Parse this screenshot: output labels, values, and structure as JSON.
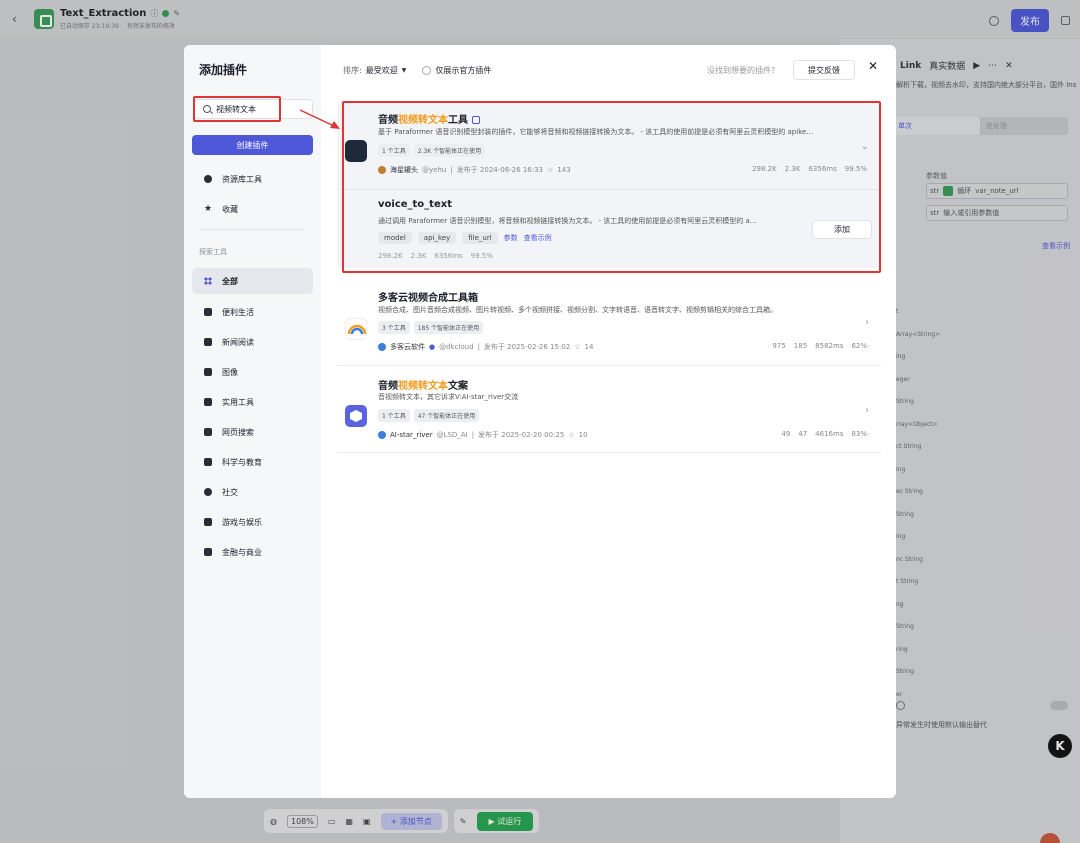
{
  "app": {
    "title": "Text_Extraction",
    "saved": "已自动保存 23:19:39",
    "unpublished": "有然未发布的修改",
    "publish": "发布"
  },
  "right_panel": {
    "title": "Link",
    "data_mode": "真实数据",
    "desc": "解析下载，视频去水印，支持国内绝大部分平台，国外 Instagram, Twitter, Tiktok, FaceBook, Vimeo。",
    "tab_single": "单次",
    "tab_batch": "批处理",
    "input_label": "参数值",
    "var_badge": "循环",
    "var_name": "var_note_url",
    "placeholder": "输入或引用参数值",
    "view_example": "查看示例",
    "type_rows": [
      "t",
      "Array<String>",
      "ing",
      "eger",
      "String",
      "rray<Object>",
      "ct  String",
      "ing",
      "ec  String",
      "String",
      "ing",
      "nc  String",
      "t  String",
      "ng",
      "String",
      "ring",
      "String",
      "er"
    ],
    "footer": "异常发生时使用默认输出替代"
  },
  "canvas": {
    "zoom": "108%",
    "add_node": "+ 添加节点",
    "run": "试运行"
  },
  "modal": {
    "title": "添加插件",
    "search_value": "视频转文本",
    "create_button": "创建插件",
    "nav_top": [
      {
        "label": "资源库工具",
        "icon": "person-icon"
      },
      {
        "label": "收藏",
        "icon": "star-icon"
      }
    ],
    "section_label": "探索工具",
    "nav_categories": [
      {
        "label": "全部",
        "icon": "grid-icon"
      },
      {
        "label": "便利生活",
        "icon": "cup-icon"
      },
      {
        "label": "新闻阅读",
        "icon": "book-icon"
      },
      {
        "label": "图像",
        "icon": "image-icon"
      },
      {
        "label": "实用工具",
        "icon": "wrench-icon"
      },
      {
        "label": "网页搜索",
        "icon": "cross-icon"
      },
      {
        "label": "科学与教育",
        "icon": "cap-icon"
      },
      {
        "label": "社交",
        "icon": "chat-icon"
      },
      {
        "label": "游戏与娱乐",
        "icon": "gamepad-icon"
      },
      {
        "label": "金融与商业",
        "icon": "coins-icon"
      }
    ],
    "sort_label": "排序:",
    "sort_value": "最受欢迎",
    "official_only": "仅展示官方插件",
    "missing": "没找到想要的插件?",
    "feedback": "提交反馈",
    "plugins": [
      {
        "name_pre": "音频",
        "name_hl": "视频转文本",
        "name_post": "工具",
        "desc": "基于 Paraformer 语音识别模型封装的插件，它能够将音频和视频链接转换为文本。 - 该工具的使用前提是必须有阿里云灵积模型的 apike…",
        "tags": [
          "1 个工具",
          "2.3K 个智能体正在使用"
        ],
        "author": "海星罐头",
        "handle": "@yehu",
        "published": "发布于 2024-06-26 16:33",
        "stars": "143",
        "stats": [
          "298.2K",
          "2.3K",
          "6356ms",
          "99.5%"
        ],
        "icon_color": "#1e2a3a"
      },
      {
        "name_pre": "多客云视频合成工具箱",
        "name_hl": "",
        "name_post": "",
        "desc": "视频合成、图片音频合成视频、图片转视频、多个视频拼接、视频分割、文字转语音、语音转文字、视频剪辑相关的综合工具箱。",
        "tags": [
          "3 个工具",
          "185 个智能体正在使用"
        ],
        "author": "多客云软件",
        "handle": "@dkcloud",
        "published": "发布于 2025-02-26 15:02",
        "stars": "14",
        "stats": [
          "975",
          "185",
          "8582ms",
          "62%"
        ],
        "icon_color": "#ffffff"
      },
      {
        "name_pre": "音频",
        "name_hl": "视频转文本",
        "name_post": "文案",
        "desc": "音视频转文本，其它诉求V:AI-star_river交流",
        "tags": [
          "1 个工具",
          "47 个智能体正在使用"
        ],
        "author": "AI-star_river",
        "handle": "@LSD_AI",
        "published": "发布于 2025-02-20 00:25",
        "stars": "10",
        "stats": [
          "49",
          "47",
          "4616ms",
          "83%"
        ],
        "icon_color": "#5a63e0"
      }
    ],
    "tool": {
      "name": "voice_to_text",
      "desc": "通过调用 Paraformer 语音识别模型，将音频和视频链接转换为文本。 - 该工具的使用前提是必须有阿里云灵积模型的 a…",
      "params": [
        "model",
        "api_key",
        "file_url"
      ],
      "params_link": "参数",
      "example_link": "查看示例",
      "stats": [
        "298.2K",
        "2.3K",
        "6356ms",
        "99.5%"
      ],
      "add": "添加"
    }
  }
}
